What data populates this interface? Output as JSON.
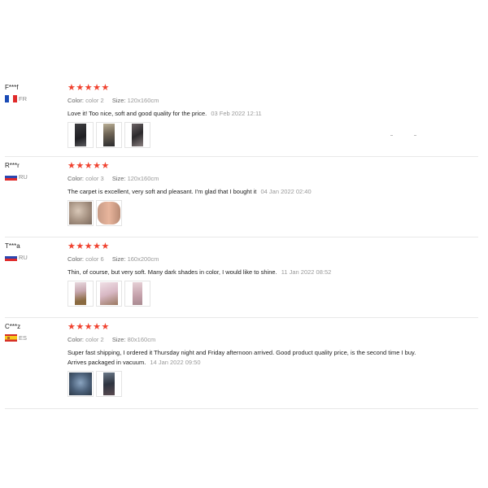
{
  "labels": {
    "color": "Color:",
    "size": "Size:"
  },
  "reviews": [
    {
      "user": "F***f",
      "country_code": "FR",
      "stars": "★★★★★",
      "color": "color 2",
      "size": "120x160cm",
      "text": "Love it! Too nice, soft and good quality for the price.",
      "date": "03 Feb 2022 12:11"
    },
    {
      "user": "R***r",
      "country_code": "RU",
      "stars": "★★★★★",
      "color": "color 3",
      "size": "120x160cm",
      "text": "The carpet is excellent, very soft and pleasant. I'm glad that I bought it",
      "date": "04 Jan 2022 02:40"
    },
    {
      "user": "T***a",
      "country_code": "RU",
      "stars": "★★★★★",
      "color": "color 6",
      "size": "160x200cm",
      "text": "Thin, of course, but very soft. Many dark shades in color, I would like to shine.",
      "date": "11 Jan 2022 08:52"
    },
    {
      "user": "C***z",
      "country_code": "ES",
      "stars": "★★★★★",
      "color": "color 2",
      "size": "80x160cm",
      "text": "Super fast shipping, I ordered it Thursday night and Friday afternoon arrived. Good product quality price, is the second time I buy. Arrives packaged in vacuum.",
      "date": "14 Jan 2022 09:50"
    }
  ]
}
